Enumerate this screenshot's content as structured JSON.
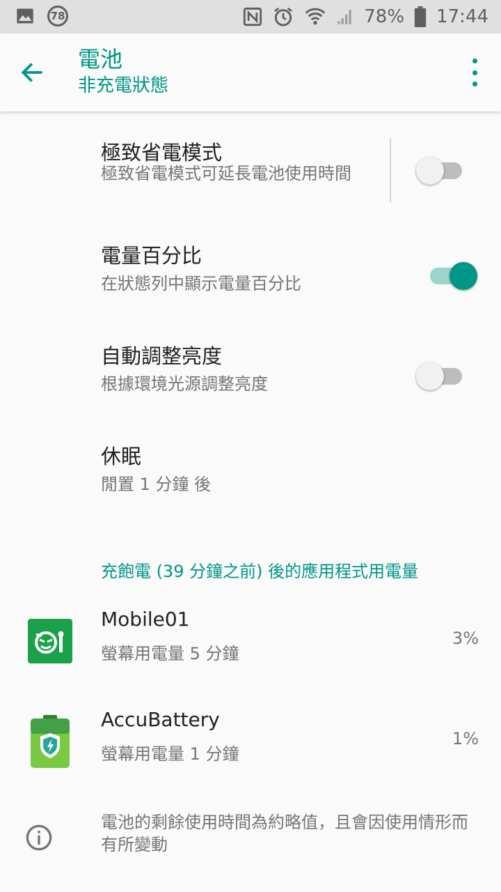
{
  "status_bar": {
    "badge": "78",
    "battery": "78%",
    "time": "17:44"
  },
  "app_bar": {
    "title": "電池",
    "subtitle": "非充電狀態"
  },
  "settings": [
    {
      "title": "極致省電模式",
      "summary": "極致省電模式可延長電池使用時間",
      "toggle": false
    },
    {
      "title": "電量百分比",
      "summary": "在狀態列中顯示電量百分比",
      "toggle": true
    },
    {
      "title": "自動調整亮度",
      "summary": "根據環境光源調整亮度",
      "toggle": false
    },
    {
      "title": "休眠",
      "summary": "閒置 1 分鐘 後"
    }
  ],
  "usage_section": {
    "header": "充飽電 (39 分鐘之前) 後的應用程式用電量",
    "apps": [
      {
        "name": "Mobile01",
        "usage": "螢幕用電量 5 分鐘",
        "percent": "3%",
        "icon": "mobile01-app-icon",
        "color": "#1aa14a"
      },
      {
        "name": "AccuBattery",
        "usage": "螢幕用電量 1 分鐘",
        "percent": "1%",
        "icon": "accubattery-app-icon",
        "color": "#7ac943"
      }
    ]
  },
  "footer": {
    "note": "電池的剩餘使用時間為約略值，且會因使用情形而有所變動",
    "icon": "info-icon"
  },
  "colors": {
    "accent": "#009688",
    "status_bar_bg": "#e0e0e0",
    "background": "#fafafa"
  }
}
